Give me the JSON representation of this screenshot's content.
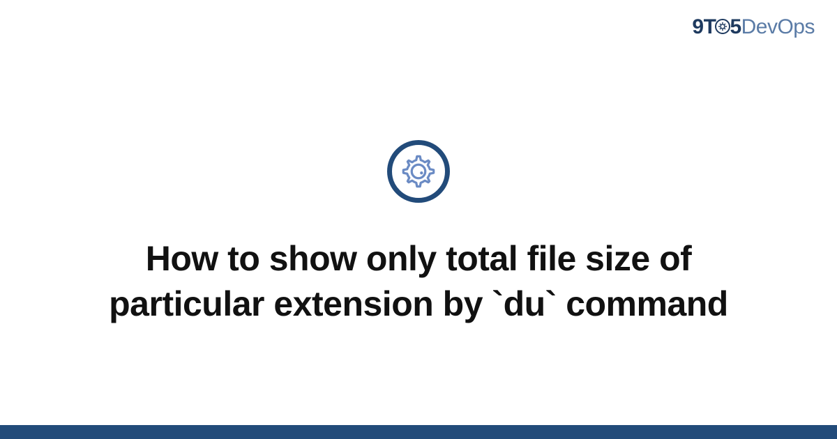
{
  "logo": {
    "part1": "9T",
    "part2": "5",
    "part3": "DevOps"
  },
  "icon": {
    "name": "gear-icon"
  },
  "title": "How to show only total file size of particular extension by `du` command",
  "colors": {
    "brand_dark": "#224b7a",
    "brand_light": "#5a7ba6",
    "text": "#111111",
    "icon_stroke": "#6b8bc4"
  }
}
